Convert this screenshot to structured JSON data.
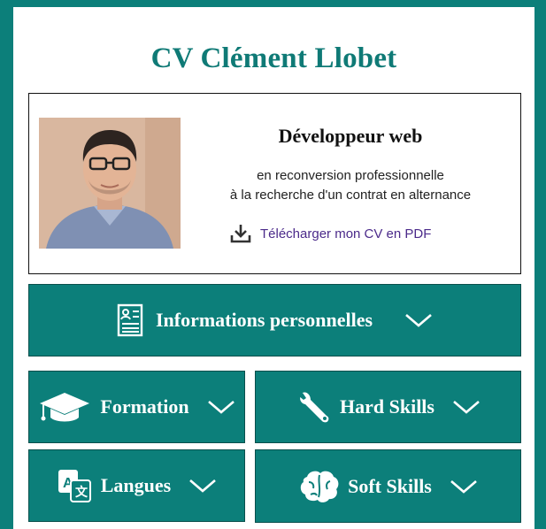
{
  "header": {
    "title": "CV Clément Llobet"
  },
  "profile": {
    "job_title": "Développeur web",
    "subtitle_line1": "en reconversion professionnelle",
    "subtitle_line2": "à la recherche d'un contrat en alternance",
    "download_label": "Télécharger mon CV en PDF",
    "download_icon": "download-icon",
    "photo": "profile-photo"
  },
  "sections": {
    "info": {
      "label": "Informations personnelles",
      "icon": "id-card-icon"
    },
    "formation": {
      "label": "Formation",
      "icon": "graduation-cap-icon"
    },
    "hard_skills": {
      "label": "Hard Skills",
      "icon": "wrench-icon"
    },
    "langues": {
      "label": "Langues",
      "icon": "translate-icon"
    },
    "soft_skills": {
      "label": "Soft Skills",
      "icon": "brain-icon"
    }
  },
  "colors": {
    "accent": "#0c7f7a",
    "title": "#0f7a76",
    "link": "#4b2a8a",
    "page_bg": "#ffffff"
  }
}
